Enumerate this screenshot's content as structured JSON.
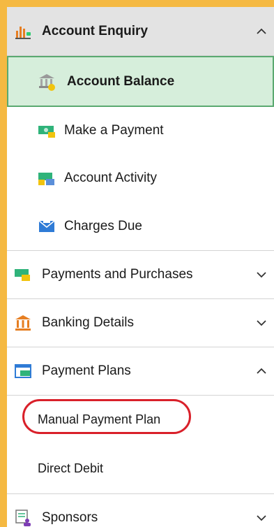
{
  "menu": {
    "account_enquiry": {
      "label": "Account Enquiry",
      "items": [
        {
          "label": "Account Balance"
        },
        {
          "label": "Make a Payment"
        },
        {
          "label": "Account Activity"
        },
        {
          "label": "Charges Due"
        }
      ]
    },
    "payments_purchases": {
      "label": "Payments and Purchases"
    },
    "banking_details": {
      "label": "Banking Details"
    },
    "payment_plans": {
      "label": "Payment Plans",
      "items": [
        {
          "label": "Manual Payment Plan"
        },
        {
          "label": "Direct Debit"
        }
      ]
    },
    "sponsors": {
      "label": "Sponsors"
    }
  },
  "colors": {
    "frame": "#f5b942",
    "active_bg": "#d6eedb",
    "active_border": "#5aa970",
    "highlight": "#d9202a"
  }
}
